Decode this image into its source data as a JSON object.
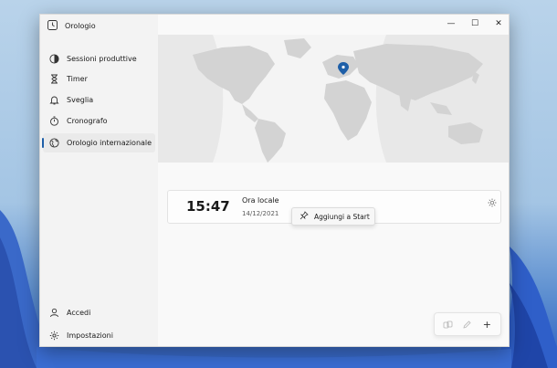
{
  "app": {
    "title": "Orologio"
  },
  "sidebar": {
    "items": [
      {
        "label": "Sessioni produttive",
        "icon": "focus-icon"
      },
      {
        "label": "Timer",
        "icon": "hourglass-icon"
      },
      {
        "label": "Sveglia",
        "icon": "bell-icon"
      },
      {
        "label": "Cronografo",
        "icon": "stopwatch-icon"
      },
      {
        "label": "Orologio internazionale",
        "icon": "globe-icon",
        "active": true
      }
    ],
    "footer": [
      {
        "label": "Accedi",
        "icon": "person-icon"
      },
      {
        "label": "Impostazioni",
        "icon": "gear-icon"
      }
    ]
  },
  "titlebar": {
    "minimize": "—",
    "maximize": "☐",
    "close": "✕"
  },
  "clock": {
    "time": "15:47",
    "label": "Ora locale",
    "date": "14/12/2021"
  },
  "tooltip": {
    "label": "Aggiungi a Start"
  },
  "toolbar": {
    "add": "+"
  },
  "colors": {
    "accent": "#1e5fa8",
    "map_land": "#d3d3d3",
    "map_night": "#e9e9e9"
  }
}
